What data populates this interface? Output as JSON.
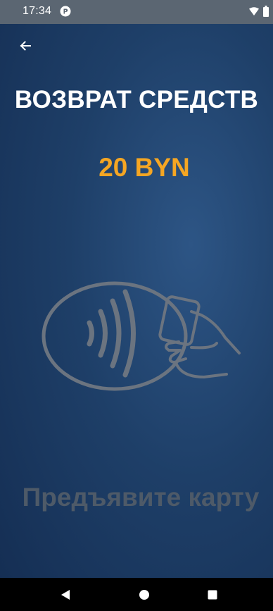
{
  "status_bar": {
    "time": "17:34"
  },
  "header": {
    "back_icon": "arrow-left-icon"
  },
  "main": {
    "title": "ВОЗВРАТ СРЕДСТВ",
    "amount": "20 BYN",
    "illustration": "contactless-payment-icon",
    "prompt": "Предъявите карту"
  },
  "colors": {
    "background": "#1e3f68",
    "title": "#ffffff",
    "amount": "#f5a623",
    "prompt": "#4e5a68",
    "illustration": "#6b7480"
  },
  "nav_bar": {
    "back_icon": "nav-back-icon",
    "home_icon": "nav-home-icon",
    "recents_icon": "nav-recents-icon"
  }
}
